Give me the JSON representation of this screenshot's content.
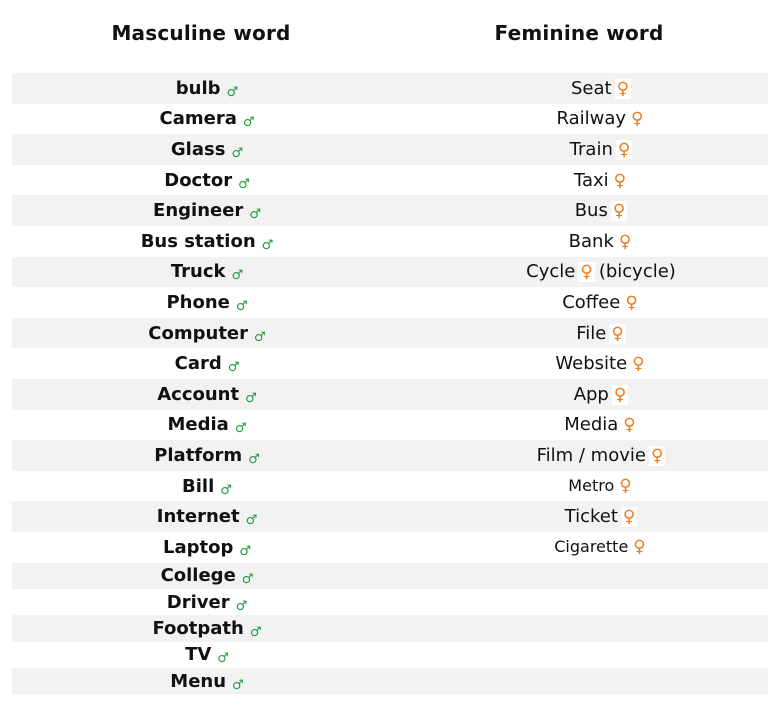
{
  "headers": {
    "masculine": "Masculine word",
    "feminine": "Feminine word"
  },
  "symbols": {
    "masculine": "♂",
    "feminine": "♀",
    "masculine_color": "#1a9a3c",
    "feminine_color": "#f07a18"
  },
  "rows": [
    {
      "masculine": "bulb",
      "feminine": "Seat",
      "feminine_suffix": ""
    },
    {
      "masculine": "Camera",
      "feminine": "Railway",
      "feminine_suffix": ""
    },
    {
      "masculine": "Glass",
      "feminine": "Train",
      "feminine_suffix": ""
    },
    {
      "masculine": "Doctor",
      "feminine": "Taxi",
      "feminine_suffix": ""
    },
    {
      "masculine": "Engineer",
      "feminine": "Bus",
      "feminine_suffix": ""
    },
    {
      "masculine": "Bus station",
      "feminine": "Bank",
      "feminine_suffix": ""
    },
    {
      "masculine": "Truck",
      "feminine": "Cycle",
      "feminine_suffix": "(bicycle)"
    },
    {
      "masculine": "Phone",
      "feminine": "Coffee",
      "feminine_suffix": ""
    },
    {
      "masculine": "Computer",
      "feminine": "File",
      "feminine_suffix": ""
    },
    {
      "masculine": "Card",
      "feminine": "Website",
      "feminine_suffix": ""
    },
    {
      "masculine": "Account",
      "feminine": "App",
      "feminine_suffix": ""
    },
    {
      "masculine": "Media",
      "feminine": "Media",
      "feminine_suffix": ""
    },
    {
      "masculine": "Platform",
      "feminine": "Film / movie",
      "feminine_suffix": ""
    },
    {
      "masculine": "Bill",
      "feminine": "Metro",
      "feminine_suffix": ""
    },
    {
      "masculine": "Internet",
      "feminine": "Ticket",
      "feminine_suffix": ""
    },
    {
      "masculine": "Laptop",
      "feminine": "Cigarette",
      "feminine_suffix": ""
    },
    {
      "masculine": "College",
      "feminine": "",
      "feminine_suffix": ""
    },
    {
      "masculine": "Driver",
      "feminine": "",
      "feminine_suffix": ""
    },
    {
      "masculine": "Footpath",
      "feminine": "",
      "feminine_suffix": ""
    },
    {
      "masculine": "TV",
      "feminine": "",
      "feminine_suffix": ""
    },
    {
      "masculine": "Menu",
      "feminine": "",
      "feminine_suffix": ""
    }
  ]
}
